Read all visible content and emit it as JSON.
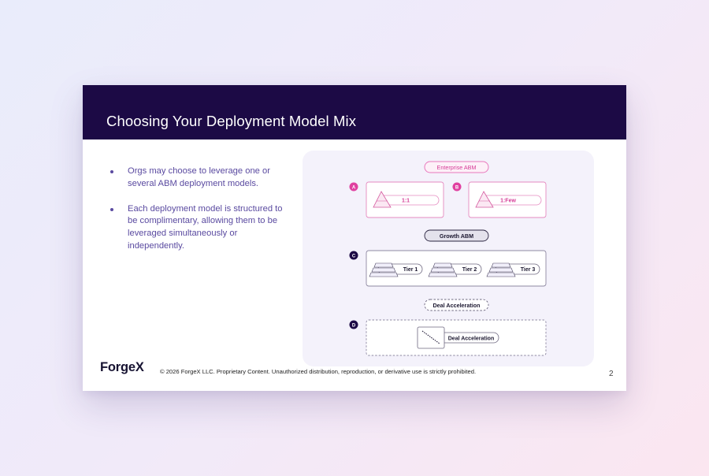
{
  "slide": {
    "title": "Choosing Your Deployment Model Mix",
    "bullets": [
      "Orgs may choose to leverage one or several ABM deployment models.",
      "Each deployment model is structured to be complimentary, allowing them to be leveraged simultaneously or independently."
    ],
    "page_number": "2"
  },
  "diagram": {
    "enterprise_label": "Enterprise ABM",
    "growth_label": "Growth ABM",
    "deal_label": "Deal Acceleration",
    "markers": [
      "A",
      "B",
      "C",
      "D"
    ],
    "card_a": "1:1",
    "card_b": "1:Few",
    "tiers": [
      "Tier 1",
      "Tier 2",
      "Tier 3"
    ],
    "card_d": "Deal Acceleration"
  },
  "footer": {
    "logo": "ForgeX",
    "copyright": "© 2026 ForgeX LLC. Proprietary Content. Unauthorized distribution, reproduction, or derivative use is strictly prohibited."
  },
  "colors": {
    "header_bg": "#1c0a45",
    "accent_pink": "#e040a0",
    "marker_dark": "#1c0a45",
    "bullet_text": "#5a4aa0"
  }
}
